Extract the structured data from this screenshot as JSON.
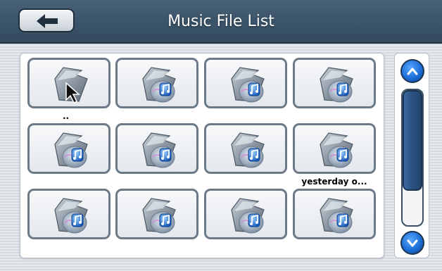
{
  "header": {
    "title": "Music File List",
    "back_icon": "arrow-left-icon"
  },
  "files": [
    {
      "label": "..",
      "icon": "parent-folder-icon"
    },
    {
      "label": "",
      "icon": "music-file-icon"
    },
    {
      "label": "",
      "icon": "music-file-icon"
    },
    {
      "label": "",
      "icon": "music-file-icon"
    },
    {
      "label": "",
      "icon": "music-file-icon"
    },
    {
      "label": "",
      "icon": "music-file-icon"
    },
    {
      "label": "",
      "icon": "music-file-icon"
    },
    {
      "label": "yesterday o...",
      "icon": "music-file-icon"
    },
    {
      "label": "",
      "icon": "music-file-icon"
    },
    {
      "label": "",
      "icon": "music-file-icon"
    },
    {
      "label": "",
      "icon": "music-file-icon"
    },
    {
      "label": "",
      "icon": "music-file-icon"
    }
  ],
  "scrollbar": {
    "up_icon": "chevron-up-icon",
    "down_icon": "chevron-down-icon",
    "position": 0
  },
  "colors": {
    "header": "#3d566c",
    "accent": "#1c6fd8",
    "tile_border": "#6c7a88"
  }
}
